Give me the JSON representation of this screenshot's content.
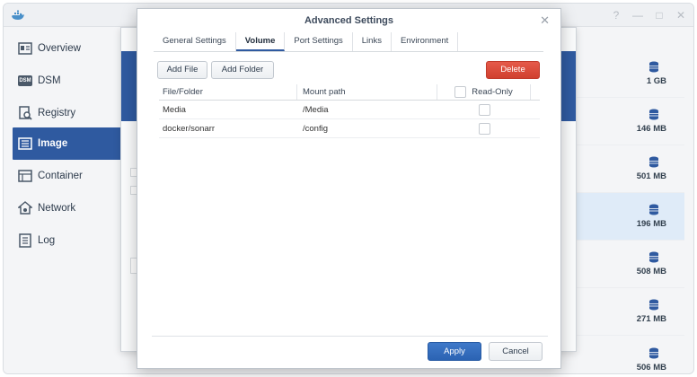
{
  "sidebar": {
    "items": [
      {
        "label": "Overview",
        "icon": "overview-icon"
      },
      {
        "label": "DSM",
        "icon": "dsm-icon"
      },
      {
        "label": "Registry",
        "icon": "registry-icon"
      },
      {
        "label": "Image",
        "icon": "image-icon",
        "active": true
      },
      {
        "label": "Container",
        "icon": "container-icon"
      },
      {
        "label": "Network",
        "icon": "network-icon"
      },
      {
        "label": "Log",
        "icon": "log-icon"
      }
    ],
    "dsm_badge": "DSM"
  },
  "image_list": {
    "sizes": [
      "1 GB",
      "146 MB",
      "501 MB",
      "196 MB",
      "508 MB",
      "271 MB",
      "506 MB"
    ],
    "selected_index": 3
  },
  "dialog": {
    "title": "Advanced Settings",
    "tabs": [
      "General Settings",
      "Volume",
      "Port Settings",
      "Links",
      "Environment"
    ],
    "active_tab": "Volume",
    "toolbar": {
      "add_file": "Add File",
      "add_folder": "Add Folder",
      "delete": "Delete"
    },
    "table": {
      "headers": [
        "File/Folder",
        "Mount path",
        "Read-Only"
      ],
      "rows": [
        {
          "file_folder": "Media",
          "mount_path": "/Media",
          "read_only": false
        },
        {
          "file_folder": "docker/sonarr",
          "mount_path": "/config",
          "read_only": false
        }
      ]
    },
    "footer": {
      "apply": "Apply",
      "cancel": "Cancel"
    }
  },
  "colors": {
    "accent": "#2f5aa0",
    "delete": "#d9493a",
    "apply": "#3470c0",
    "selected_row": "#dfebf8"
  }
}
